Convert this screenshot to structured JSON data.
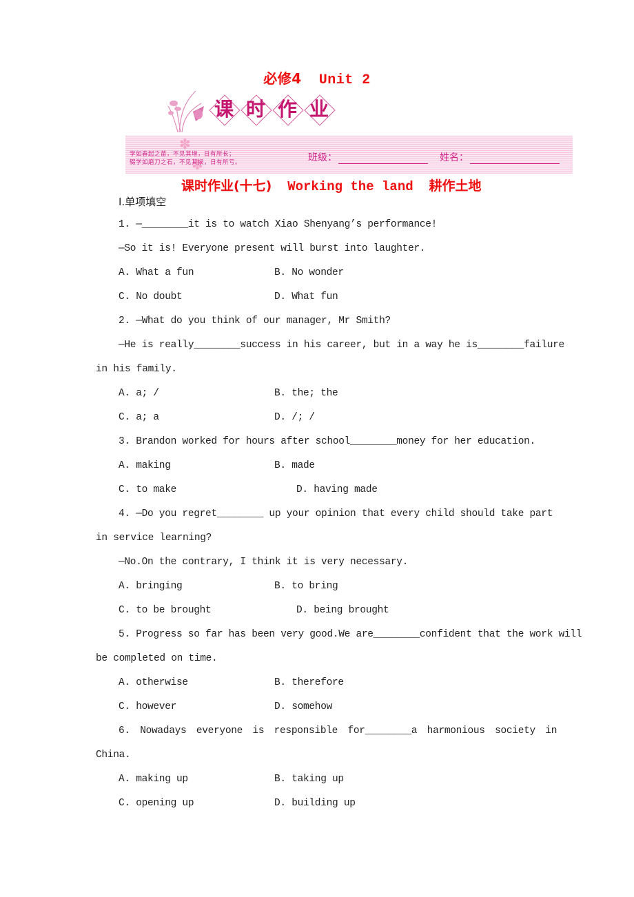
{
  "header": {
    "unit_title_cn": "必修4",
    "unit_title_en": "Unit 2",
    "banner_chars": [
      "课",
      "时",
      "作",
      "业"
    ],
    "proverb_line1": "学如春起之苗，不见其增，日有所长；",
    "proverb_line2": "辍学如磨刀之石，不见其损，日有所亏。",
    "class_label": "班级：",
    "name_label": "姓名：",
    "lesson_title_cn1": "课时作业(十七)",
    "lesson_title_en": "Working the land",
    "lesson_title_cn2": "耕作土地",
    "colors": {
      "title_red": "#ee1111",
      "banner_pink": "#d0288a",
      "banner_bg": "#fbe6f1"
    }
  },
  "section": {
    "heading": "Ⅰ.单项填空"
  },
  "questions": [
    {
      "lines": [
        "1. —________it is to watch Xiao Shenyang’s performance!",
        "—So it is! Everyone present will burst into laughter."
      ],
      "options": [
        "A. What a fun",
        "B. No wonder",
        "C. No doubt",
        "D. What fun"
      ]
    },
    {
      "lines": [
        "2. —What do you think of our manager, Mr Smith?",
        "—He is really________success in his career, but in a way he is________failure",
        "in his family."
      ],
      "options": [
        "A. a; /",
        "B. the; the",
        "C. a; a",
        "D. /; /"
      ]
    },
    {
      "lines": [
        "3. Brandon worked for hours after school________money for her education."
      ],
      "options": [
        "A. making",
        "B. made",
        "C. to make",
        "D. having made"
      ]
    },
    {
      "lines": [
        "4. —Do you regret________ up your opinion that every child should take part",
        "in service learning?",
        "—No.On the contrary, I think it is very necessary."
      ],
      "options": [
        "A. bringing",
        "B. to bring",
        "C. to be brought",
        "D. being brought"
      ]
    },
    {
      "lines": [
        "5. Progress so far has been very good.We are________confident that the work will",
        "be completed on time."
      ],
      "options": [
        "A. otherwise",
        "B. therefore",
        "C. however",
        "D. somehow"
      ]
    },
    {
      "lines": [
        "6. Nowadays everyone is responsible for________a harmonious society in",
        "China."
      ],
      "options": [
        "A. making up",
        "B. taking up",
        "C. opening up",
        "D. building up"
      ]
    }
  ]
}
